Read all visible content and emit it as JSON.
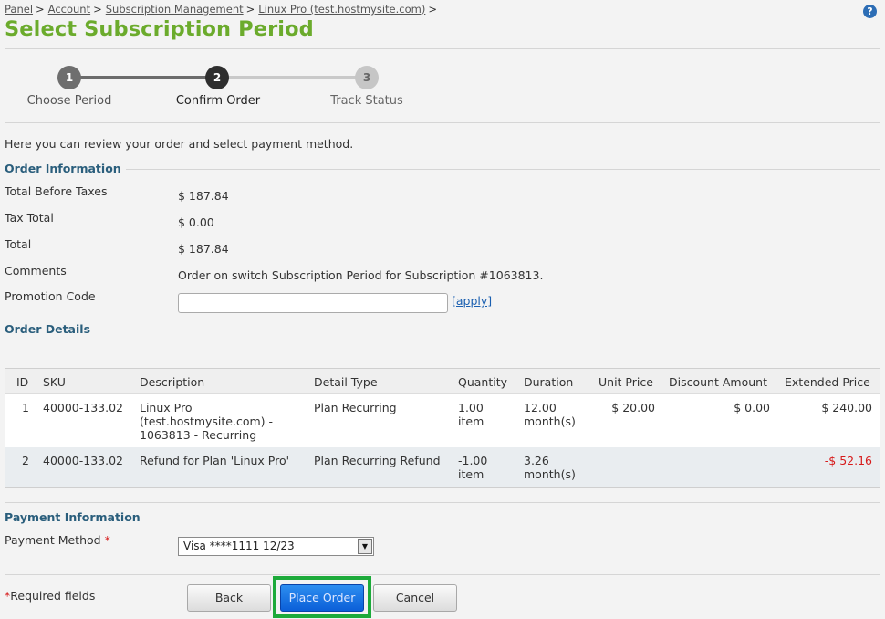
{
  "breadcrumb": [
    "Panel",
    "Account",
    "Subscription Management",
    "Linux Pro (test.hostmysite.com)"
  ],
  "page_title": "Select Subscription Period",
  "steps": [
    {
      "number": "1",
      "label": "Choose Period"
    },
    {
      "number": "2",
      "label": "Confirm Order"
    },
    {
      "number": "3",
      "label": "Track Status"
    }
  ],
  "intro": "Here you can review your order and select payment method.",
  "order_info": {
    "title": "Order Information",
    "total_before_taxes_label": "Total Before Taxes",
    "total_before_taxes": "$ 187.84",
    "tax_total_label": "Tax Total",
    "tax_total": "$ 0.00",
    "total_label": "Total",
    "total": "$ 187.84",
    "comments_label": "Comments",
    "comments": "Order on switch Subscription Period for Subscription #1063813.",
    "promo_label": "Promotion Code",
    "promo_value": "",
    "apply_label": "[apply]"
  },
  "order_details": {
    "title": "Order Details",
    "columns": [
      "ID",
      "SKU",
      "Description",
      "Detail Type",
      "Quantity",
      "Duration",
      "Unit Price",
      "Discount Amount",
      "Extended Price"
    ],
    "rows": [
      {
        "id": "1",
        "sku": "40000-133.02",
        "desc1": "Linux Pro",
        "desc2": "(test.hostmysite.com) -",
        "desc3": "1063813 - Recurring",
        "detail_type": "Plan Recurring",
        "qty1": "1.00",
        "qty2": "item",
        "dur1": "12.00",
        "dur2": "month(s)",
        "unit_price": "$ 20.00",
        "discount": "$ 0.00",
        "extended": "$ 240.00"
      },
      {
        "id": "2",
        "sku": "40000-133.02",
        "desc1": "Refund for Plan 'Linux Pro'",
        "detail_type": "Plan Recurring Refund",
        "qty1": "-1.00",
        "qty2": "item",
        "dur1": "3.26",
        "dur2": "month(s)",
        "extended": "-$ 52.16"
      }
    ]
  },
  "payment": {
    "title": "Payment Information",
    "method_label": "Payment Method",
    "required_mark": "*",
    "selected": "Visa ****1111 12/23"
  },
  "footer": {
    "required_mark": "*",
    "required_text": "Required fields",
    "back": "Back",
    "place_order": "Place Order",
    "cancel": "Cancel"
  }
}
